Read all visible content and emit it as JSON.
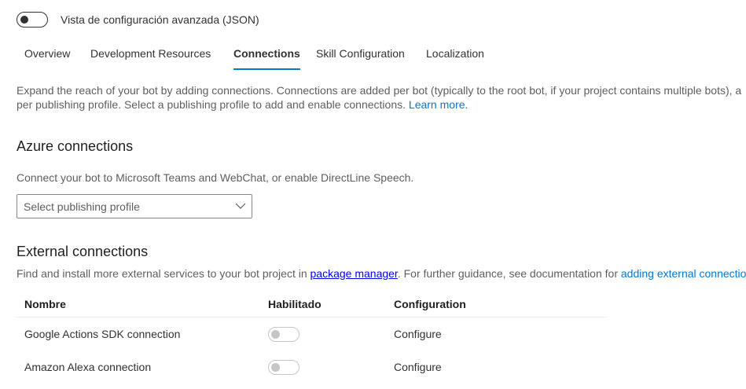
{
  "advanced_toggle": {
    "label": "Vista de configuración avanzada (JSON)",
    "on": false
  },
  "tabs": [
    {
      "label": "Overview",
      "active": false
    },
    {
      "label": "Development Resources",
      "active": false
    },
    {
      "label": "Connections",
      "active": true
    },
    {
      "label": "Skill Configuration",
      "active": false
    },
    {
      "label": "Localization",
      "active": false
    }
  ],
  "intro": {
    "line1": "Expand the reach of your bot by adding connections. Connections are added per bot (typically to the root bot, if your project contains multiple bots), a",
    "line2": "per publishing profile. Select a publishing profile to add and enable connections.",
    "learn_more": "Learn more."
  },
  "azure": {
    "title": "Azure connections",
    "description": "Connect your bot to Microsoft Teams and WebChat, or enable DirectLine Speech.",
    "dropdown_placeholder": "Select publishing profile"
  },
  "external": {
    "title": "External connections",
    "desc_prefix": "Find and install more external services to your bot project in",
    "package_manager": "package manager",
    "desc_middle": ". For further guidance, see documentation for",
    "adding_link": "adding external connectio",
    "columns": {
      "name": "Nombre",
      "enabled": "Habilitado",
      "config": "Configuration"
    },
    "rows": [
      {
        "name": "Google Actions SDK connection",
        "enabled": false,
        "config": "Configure"
      },
      {
        "name": "Amazon Alexa connection",
        "enabled": false,
        "config": "Configure"
      }
    ]
  },
  "colors": {
    "accent": "#0078d4",
    "text": "#323130",
    "subtle_text": "#605e5c"
  },
  "icons": {
    "dropdown": "chevron-down-icon"
  }
}
